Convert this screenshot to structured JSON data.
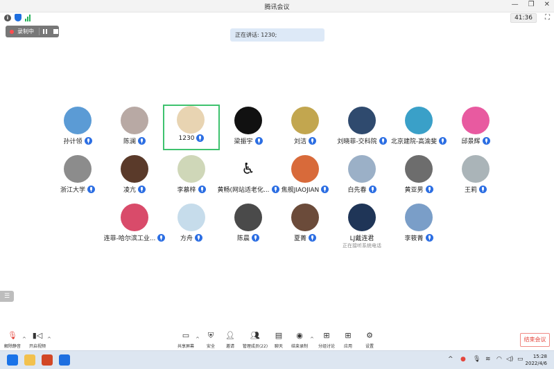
{
  "window": {
    "title": "腾讯会议"
  },
  "status": {
    "timer": "41:36"
  },
  "recording": {
    "label": "录制中"
  },
  "speaking": {
    "text": "正在讲话: 1230;"
  },
  "participants": [
    {
      "name": "孙计领",
      "color": "#5b9bd5"
    },
    {
      "name": "陈澜",
      "color": "#b8a9a4"
    },
    {
      "name": "1230",
      "color": "#e8d4b2",
      "active": true
    },
    {
      "name": "梁振宇",
      "color": "#111111"
    },
    {
      "name": "刘洁",
      "color": "#c2a64f"
    },
    {
      "name": "刘晓菲-交科院",
      "color": "#2f4a6e"
    },
    {
      "name": "北京建院-高渝斐",
      "color": "#3aa0c8"
    },
    {
      "name": "邱景辉",
      "color": "#e85aa0"
    },
    {
      "name": "浙江大学",
      "color": "#8c8c8c"
    },
    {
      "name": "凌亢",
      "color": "#5a3a2a"
    },
    {
      "name": "李慕梓",
      "color": "#cfd7b8"
    },
    {
      "name": "黄畅(网站适老化...",
      "color": "#ffffff"
    },
    {
      "name": "焦舰JIAOJIAN",
      "color": "#d86a3a"
    },
    {
      "name": "白先春",
      "color": "#9bb0c7"
    },
    {
      "name": "黄亚男",
      "color": "#6d6d6d"
    },
    {
      "name": "王莉",
      "color": "#aab4b8"
    },
    {
      "name": "连菲-哈尔滨工业...",
      "color": "#d94b6a"
    },
    {
      "name": "方舟",
      "color": "#c6dceb"
    },
    {
      "name": "陈晨",
      "color": "#4a4a4a"
    },
    {
      "name": "夏菁",
      "color": "#6b4b3a"
    },
    {
      "name": "LJ戴连君",
      "color": "#1f3557",
      "subtext": "正在接听系统电话"
    },
    {
      "name": "李筱菁",
      "color": "#7a9ec8"
    }
  ],
  "toolbar": {
    "unmute": "解除静音",
    "video": "开启视频",
    "share": "共享屏幕",
    "security": "安全",
    "invite": "邀请",
    "members": "管理成员(22)",
    "chat": "聊天",
    "end_record": "结束录制",
    "breakout": "分组讨论",
    "apps": "应用",
    "settings": "设置",
    "end_meeting": "结束会议"
  },
  "taskbar": {
    "time": "15:28",
    "date": "2022/4/6"
  }
}
